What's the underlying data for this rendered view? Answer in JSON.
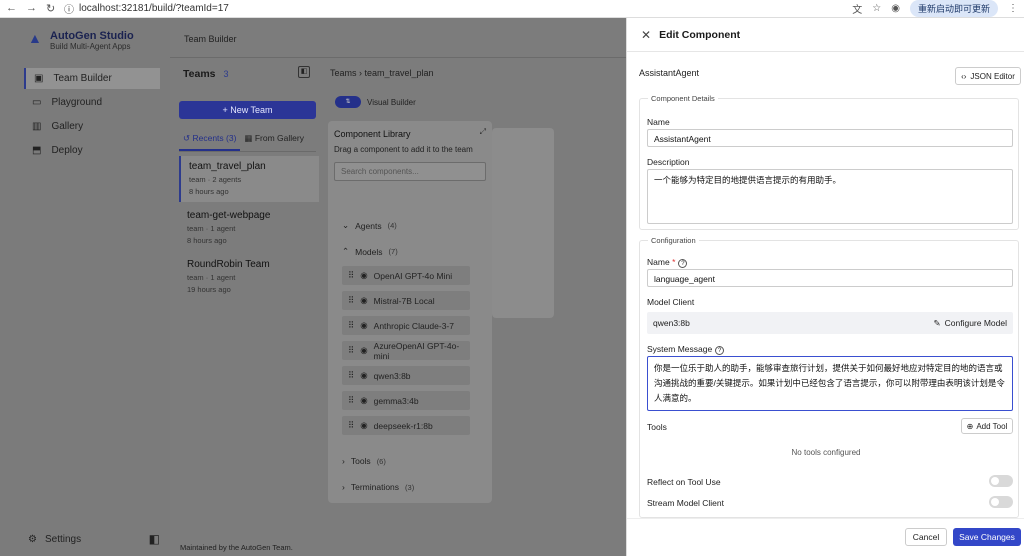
{
  "browser": {
    "url": "localhost:32181/build/?teamId=17",
    "restart_label": "重新启动即可更新"
  },
  "app": {
    "name": "AutoGen Studio",
    "tagline": "Build Multi-Agent Apps"
  },
  "sidebar": {
    "items": [
      {
        "label": "Team Builder"
      },
      {
        "label": "Playground"
      },
      {
        "label": "Gallery"
      },
      {
        "label": "Deploy"
      }
    ],
    "settings_label": "Settings"
  },
  "topbar": {
    "title": "Team Builder"
  },
  "teams": {
    "header": "Teams",
    "count": "3",
    "new_team_label": "+  New Team",
    "tabs": [
      {
        "label": "Recents (3)"
      },
      {
        "label": "From Gallery"
      }
    ],
    "list": [
      {
        "name": "team_travel_plan",
        "meta": "team  ·  2 agents",
        "time": "8 hours ago"
      },
      {
        "name": "team-get-webpage",
        "meta": "team  ·  1 agent",
        "time": "8 hours ago"
      },
      {
        "name": "RoundRobin Team",
        "meta": "team  ·  1 agent",
        "time": "19 hours ago"
      }
    ],
    "footer": "Maintained by the AutoGen Team."
  },
  "canvas": {
    "breadcrumb": "Teams  ›  team_travel_plan",
    "visual_builder_label": "Visual Builder",
    "library": {
      "title": "Component Library",
      "subtitle": "Drag a component to add it to the team",
      "search_placeholder": "Search components...",
      "sections": [
        {
          "label": "Agents",
          "count": "(4)"
        },
        {
          "label": "Models",
          "count": "(7)"
        },
        {
          "label": "Tools",
          "count": "(6)"
        },
        {
          "label": "Terminations",
          "count": "(3)"
        }
      ],
      "models": [
        "OpenAI GPT-4o Mini",
        "Mistral-7B Local",
        "Anthropic Claude-3-7",
        "AzureOpenAI GPT-4o-mini",
        "qwen3:8b",
        "gemma3:4b",
        "deepseek-r1:8b"
      ]
    }
  },
  "drawer": {
    "title": "Edit Component",
    "component_type": "AssistantAgent",
    "json_editor_label": "JSON Editor",
    "details_legend": "Component Details",
    "name_label": "Name",
    "name_value": "AssistantAgent",
    "description_label": "Description",
    "description_value": "一个能够为特定目的地提供语言提示的有用助手。",
    "config_legend": "Configuration",
    "config_name_label": "Name",
    "config_name_value": "language_agent",
    "model_client_label": "Model Client",
    "model_client_value": "qwen3:8b",
    "configure_model_label": "Configure Model",
    "system_message_label": "System Message",
    "system_message_value": "你是一位乐于助人的助手，能够审查旅行计划，提供关于如何最好地应对特定目的地的语言或沟通挑战的重要/关键提示。如果计划中已经包含了语言提示，你可以附带理由表明该计划是令人满意的。",
    "tools_label": "Tools",
    "add_tool_label": "Add Tool",
    "no_tools": "No tools configured",
    "reflect_label": "Reflect on Tool Use",
    "stream_label": "Stream Model Client",
    "cancel_label": "Cancel",
    "save_label": "Save Changes"
  }
}
